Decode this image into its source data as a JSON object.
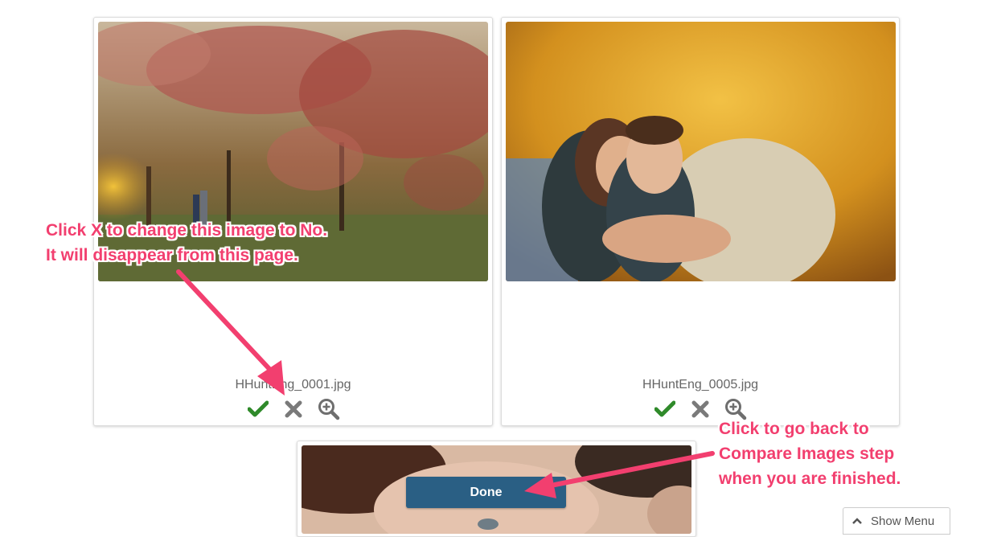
{
  "cards": [
    {
      "filename": "HHuntEng_0001.jpg"
    },
    {
      "filename": "HHuntEng_0005.jpg"
    }
  ],
  "icons": {
    "approve": "checkmark-icon",
    "reject": "x-icon",
    "zoom": "zoom-in-icon",
    "menu": "chevron-up-icon"
  },
  "colors": {
    "approve": "#2f8a2a",
    "reject": "#7a7a7a",
    "zoom": "#6e6e6e",
    "button": "#2a5f84",
    "annotation": "#f23f6f"
  },
  "done_button": {
    "label": "Done"
  },
  "show_menu": {
    "label": "Show Menu"
  },
  "annotations": {
    "x_tip": {
      "line1": "Click X to change this image to No.",
      "line2": "It will disappear from this page."
    },
    "done_tip": {
      "line1": "Click to go back to",
      "line2": "Compare Images step",
      "line3": "when you are finished."
    }
  }
}
